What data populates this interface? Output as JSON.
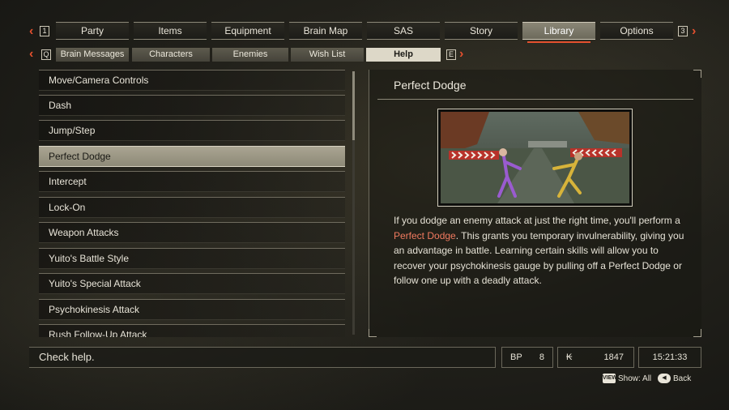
{
  "top_nav": {
    "left_key": "1",
    "right_key": "3",
    "tabs": [
      {
        "label": "Party"
      },
      {
        "label": "Items"
      },
      {
        "label": "Equipment"
      },
      {
        "label": "Brain Map"
      },
      {
        "label": "SAS"
      },
      {
        "label": "Story"
      },
      {
        "label": "Library",
        "active": true
      },
      {
        "label": "Options"
      }
    ]
  },
  "sub_nav": {
    "left_key": "Q",
    "right_key": "E",
    "tabs": [
      {
        "label": "Brain Messages"
      },
      {
        "label": "Characters"
      },
      {
        "label": "Enemies"
      },
      {
        "label": "Wish List"
      },
      {
        "label": "Help",
        "active": true
      }
    ]
  },
  "help_list": {
    "items": [
      {
        "label": "Move/Camera Controls"
      },
      {
        "label": "Dash"
      },
      {
        "label": "Jump/Step"
      },
      {
        "label": "Perfect Dodge",
        "selected": true
      },
      {
        "label": "Intercept"
      },
      {
        "label": "Lock-On"
      },
      {
        "label": "Weapon Attacks"
      },
      {
        "label": "Yuito's Battle Style"
      },
      {
        "label": "Yuito's Special Attack"
      },
      {
        "label": "Psychokinesis Attack"
      },
      {
        "label": "Rush Follow-Up Attack"
      }
    ]
  },
  "detail": {
    "title": "Perfect Dodge",
    "desc_before": "If you dodge an enemy attack at just the right time, you'll perform a ",
    "desc_highlight": "Perfect Dodge",
    "desc_after": ". This grants you temporary invulnerability, giving you an advantage in battle. Learning certain skills will allow you to recover your psychokinesis gauge by pulling off a Perfect Dodge or follow one up with a deadly attack."
  },
  "status": {
    "help_text": "Check help.",
    "bp_label": "BP",
    "bp_value": "8",
    "currency_symbol": "₭",
    "currency_value": "1847",
    "time": "15:21:33"
  },
  "footer": {
    "show_all_icon": "VIEW",
    "show_all_label": "Show: All",
    "back_label": "Back"
  },
  "colors": {
    "accent": "#e4502e",
    "highlight_text": "#f07a5f"
  }
}
